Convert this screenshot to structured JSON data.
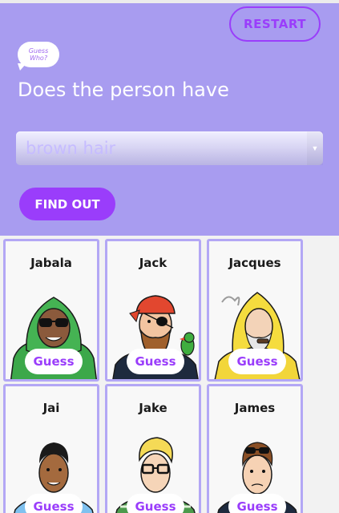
{
  "header": {
    "restart_label": "RESTART",
    "logo_line1": "Guess",
    "logo_line2": "Who?",
    "question": "Does the person have",
    "select_value": "brown hair",
    "select_arrow": "▼",
    "find_out_label": "FIND OUT"
  },
  "colors": {
    "header_bg": "#a89cf0",
    "accent": "#9a3dfb",
    "card_border": "#b3a7f5"
  },
  "cards": [
    {
      "name": "Jabala",
      "guess_label": "Guess",
      "portrait_icon": "woman-green-hijab-sunglasses"
    },
    {
      "name": "Jack",
      "guess_label": "Guess",
      "portrait_icon": "pirate-with-parrot"
    },
    {
      "name": "Jacques",
      "guess_label": "Guess",
      "portrait_icon": "sailor-yellow-raincoat-pipe"
    },
    {
      "name": "Jai",
      "guess_label": "Guess",
      "portrait_icon": "man-blue-shirt-tie"
    },
    {
      "name": "Jake",
      "guess_label": "Guess",
      "portrait_icon": "blond-man-glasses-plaid"
    },
    {
      "name": "James",
      "guess_label": "Guess",
      "portrait_icon": "man-sunglasses-on-head"
    }
  ]
}
